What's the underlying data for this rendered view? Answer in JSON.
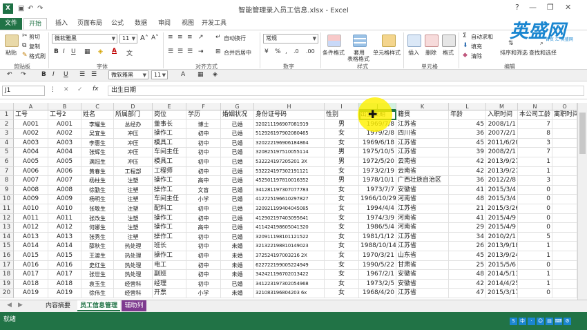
{
  "window": {
    "title": "智能管理录入员工信息.xlsx - Excel",
    "app_icon": "X",
    "minimize": "—",
    "restore": "❐",
    "close": "✕",
    "help": "?"
  },
  "ribbon_tabs": [
    "文件",
    "开始",
    "插入",
    "页面布局",
    "公式",
    "数据",
    "审阅",
    "视图",
    "开发工具"
  ],
  "ribbon": {
    "clipboard": {
      "cut": "剪切",
      "copy": "复制",
      "format_painter": "格式刷",
      "paste": "粘贴",
      "label": "剪贴板"
    },
    "font": {
      "family": "微软雅黑",
      "size": "11",
      "label": "字体"
    },
    "alignment": {
      "wrap": "自动换行",
      "merge": "合并后居中",
      "label": "对齐方式"
    },
    "number": {
      "format": "常规",
      "label": "数字"
    },
    "styles": {
      "conditional": "条件格式",
      "table_1": "套用",
      "table_2": "表格格式",
      "cell_styles": "单元格样式",
      "label": "样式"
    },
    "cells": {
      "insert": "插入",
      "delete": "删除",
      "format": "格式",
      "label": "单元格"
    },
    "editing": {
      "autosum": "自动求和",
      "fill": "填充",
      "clear": "清除",
      "sort": "排序和筛选",
      "find": "查找和选择",
      "label": "编辑"
    }
  },
  "format_bar": {
    "font_family": "微软雅黑",
    "font_size": "11"
  },
  "formula_bar": {
    "name_box": "J1",
    "fx": "fx",
    "value": "出生日期"
  },
  "columns": [
    "A",
    "B",
    "C",
    "D",
    "E",
    "F",
    "G",
    "H",
    "I",
    "J",
    "K",
    "L",
    "M",
    "N",
    "O"
  ],
  "selected_column": "J",
  "header_row": [
    "工号",
    "工号2",
    "姓名",
    "所属部门",
    "岗位",
    "学历",
    "婚姻状况",
    "身份证号码",
    "性别",
    "出生日期",
    "籍贯",
    "年龄",
    "入职时间",
    "本公司工龄",
    "离职时间"
  ],
  "rows": [
    [
      "A001",
      "A001",
      "李耀生",
      "总经办",
      "董事长",
      "博士",
      "已婚",
      "320211196907081919",
      "男",
      "1969/7/8",
      "江苏省",
      "45",
      "2008/1/1",
      "7",
      ""
    ],
    [
      "A002",
      "A002",
      "吴宜生",
      "冲压",
      "操作工",
      "初中",
      "已婚",
      "512926197902080465",
      "女",
      "1979/2/8",
      "四川省",
      "36",
      "2007/2/1",
      "8",
      ""
    ],
    [
      "A003",
      "A003",
      "李惠生",
      "冲压",
      "模具工",
      "初中",
      "已婚",
      "320222196906184864",
      "女",
      "1969/6/18",
      "江苏省",
      "45",
      "2011/6/20",
      "3",
      ""
    ],
    [
      "A004",
      "A004",
      "张辉生",
      "冲压",
      "车间主任",
      "初中",
      "已婚",
      "320825197510055114",
      "男",
      "1975/10/5",
      "江苏省",
      "39",
      "2008/2/1",
      "7",
      ""
    ],
    [
      "A005",
      "A005",
      "满冠生",
      "冲压",
      "模具工",
      "初中",
      "已婚",
      "532224197205201 3X",
      "男",
      "1972/5/20",
      "云南省",
      "42",
      "2013/9/27",
      "1",
      ""
    ],
    [
      "A006",
      "A006",
      "黄春生",
      "工程部",
      "工程师",
      "初中",
      "已婚",
      "532224197302191121",
      "女",
      "1973/2/19",
      "云南省",
      "42",
      "2013/9/27",
      "1",
      ""
    ],
    [
      "A007",
      "A007",
      "杨柱生",
      "注塑",
      "操作工",
      "高中",
      "已婚",
      "452501197810016352",
      "男",
      "1978/10/1",
      "广西壮族自治区",
      "36",
      "2012/2/8",
      "3",
      ""
    ],
    [
      "A008",
      "A008",
      "徐勤生",
      "注塑",
      "操作工",
      "文盲",
      "已婚",
      "341281197307077783",
      "女",
      "1973/7/7",
      "安徽省",
      "41",
      "2015/3/4",
      "0",
      ""
    ],
    [
      "A009",
      "A009",
      "杨明生",
      "注塑",
      "车间主任",
      "小学",
      "已婚",
      "412725196610297827",
      "女",
      "1966/10/29",
      "河南省",
      "48",
      "2015/3/4",
      "0",
      ""
    ],
    [
      "A010",
      "A010",
      "张敬生",
      "注塑",
      "配料工",
      "初中",
      "已婚",
      "320921199404045085",
      "女",
      "1994/4/4",
      "江苏省",
      "21",
      "2015/3/26",
      "0",
      ""
    ],
    [
      "A011",
      "A011",
      "张改生",
      "注塑",
      "操作工",
      "初中",
      "已婚",
      "412902197403095641",
      "女",
      "1974/3/9",
      "河南省",
      "41",
      "2015/4/9",
      "0",
      ""
    ],
    [
      "A012",
      "A012",
      "何娜生",
      "注塑",
      "操作工",
      "高中",
      "已婚",
      "411424198605041320",
      "女",
      "1986/5/4",
      "河南省",
      "29",
      "2015/4/9",
      "0",
      ""
    ],
    [
      "A013",
      "A013",
      "张秀生",
      "注塑",
      "操作工",
      "初中",
      "已婚",
      "320911198101121522",
      "女",
      "1981/1/12",
      "江苏省",
      "34",
      "2010/2/1",
      "5",
      ""
    ],
    [
      "A014",
      "A014",
      "薛秋生",
      "热处理",
      "班长",
      "初中",
      "未婚",
      "321322198810149023",
      "女",
      "1988/10/14",
      "江苏省",
      "26",
      "2013/9/18",
      "1",
      ""
    ],
    [
      "A015",
      "A015",
      "王渡生",
      "热处理",
      "操作工",
      "初中",
      "未婚",
      "372524197003216 2X",
      "女",
      "1970/3/21",
      "山东省",
      "45",
      "2013/9/24",
      "1",
      ""
    ],
    [
      "A016",
      "A016",
      "史红生",
      "热处理",
      "电工",
      "初中",
      "未婚",
      "622722199005224949",
      "女",
      "1990/5/22",
      "甘肃省",
      "25",
      "2015/5/6",
      "0",
      ""
    ],
    [
      "A017",
      "A017",
      "张世生",
      "热处理",
      "副班",
      "初中",
      "未婚",
      "342421196702013422",
      "女",
      "1967/2/1",
      "安徽省",
      "48",
      "2014/5/13",
      "1",
      ""
    ],
    [
      "A018",
      "A018",
      "袁玉生",
      "经营科",
      "经理",
      "初中",
      "已婚",
      "341223197302054968",
      "女",
      "1973/2/5",
      "安徽省",
      "42",
      "2014/4/25",
      "1",
      ""
    ],
    [
      "A019",
      "A019",
      "徐伟生",
      "经营科",
      "开票",
      "小学",
      "未婚",
      "321083196804203 6x",
      "女",
      "1968/4/20",
      "江苏省",
      "47",
      "2015/3/17",
      "0",
      ""
    ]
  ],
  "sheet_tabs": [
    "内容摘要",
    "员工信息管理",
    "辅助列"
  ],
  "active_sheet": "员工信息管理",
  "status": {
    "text": "就绪",
    "tray": [
      "S",
      "中",
      "·",
      "☺",
      "▤",
      "⌨",
      "⚙"
    ]
  },
  "watermark": {
    "brand": "英盛网",
    "sub": "首页 汇 英盛网"
  },
  "colors": {
    "excel_green": "#217346",
    "helper_tab": "#7e3a8f",
    "cursor_highlight": "#fff000",
    "watermark": "#1a86d0"
  }
}
